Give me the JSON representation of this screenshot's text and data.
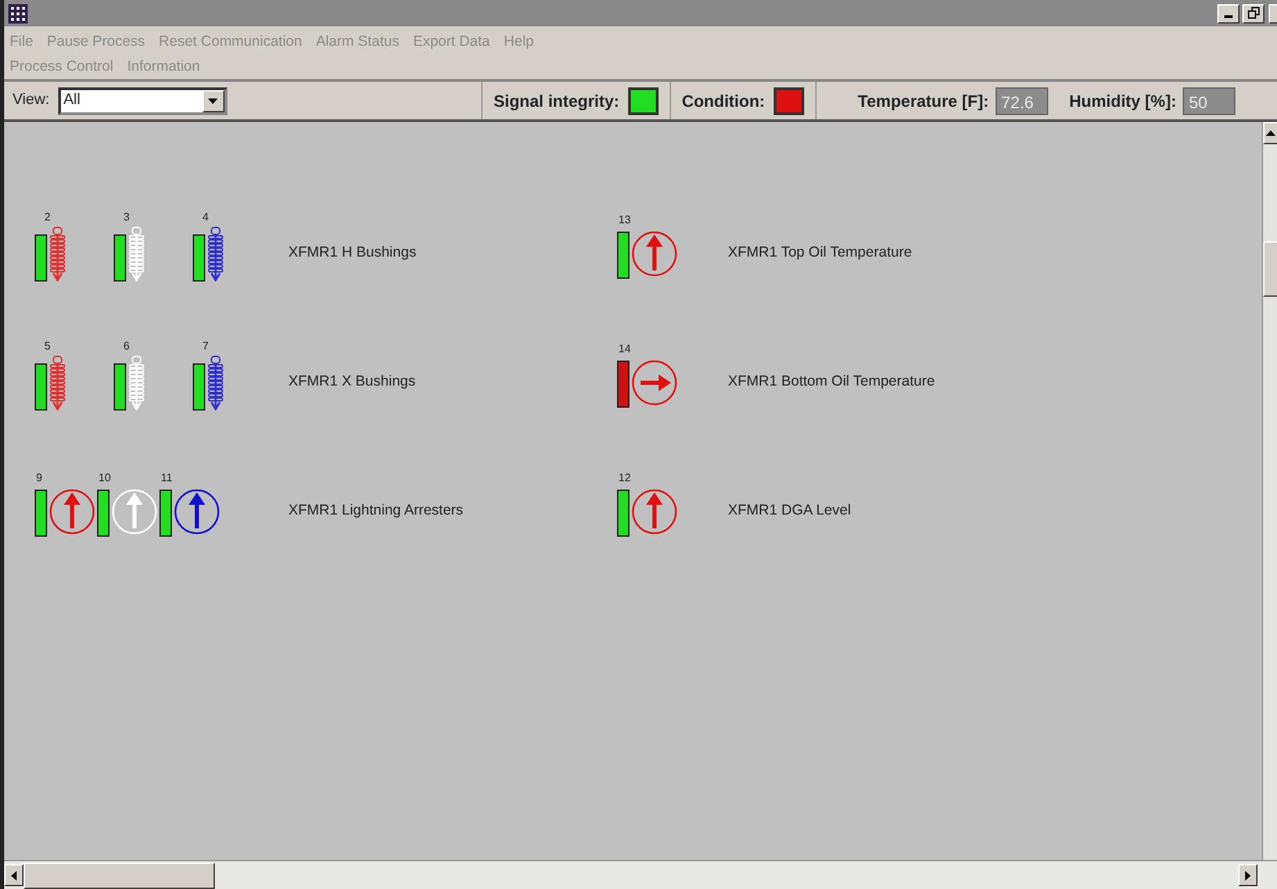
{
  "menu": [
    {
      "label": "File"
    },
    {
      "label": "Pause Process"
    },
    {
      "label": "Reset Communication"
    },
    {
      "label": "Alarm Status"
    },
    {
      "label": "Export Data"
    },
    {
      "label": "Help"
    },
    {
      "label": "Process Control"
    },
    {
      "label": "Information"
    }
  ],
  "toolbar": {
    "view_label": "View:",
    "view_value": "All",
    "indicators": [
      {
        "label": "Signal integrity:",
        "color": "#22dd22"
      },
      {
        "label": "Condition:",
        "color": "#dd1111"
      }
    ],
    "readings": [
      {
        "label": "Temperature [F]:",
        "value": "72.6"
      },
      {
        "label": "Humidity [%]:",
        "value": "50"
      }
    ]
  },
  "groups": [
    {
      "label": "XFMR1 H Bushings",
      "devices": [
        {
          "number": "2",
          "bar": {
            "color": "#22dd22"
          },
          "icon": {
            "kind": "bushing",
            "color": "#e03030"
          }
        },
        {
          "number": "3",
          "bar": {
            "color": "#22dd22"
          },
          "icon": {
            "kind": "bushing",
            "color": "#ffffff"
          }
        },
        {
          "number": "4",
          "bar": {
            "color": "#22dd22"
          },
          "icon": {
            "kind": "bushing",
            "color": "#3030d0"
          }
        }
      ]
    },
    {
      "label": "XFMR1 Top Oil Temperature",
      "devices": [
        {
          "number": "13",
          "bar": {
            "color": "#22dd22"
          },
          "icon": {
            "kind": "arrow-up",
            "color": "#e01010"
          }
        }
      ]
    },
    {
      "label": "XFMR1 X Bushings",
      "devices": [
        {
          "number": "5",
          "bar": {
            "color": "#22dd22"
          },
          "icon": {
            "kind": "bushing",
            "color": "#e03030"
          }
        },
        {
          "number": "6",
          "bar": {
            "color": "#22dd22"
          },
          "icon": {
            "kind": "bushing",
            "color": "#ffffff"
          }
        },
        {
          "number": "7",
          "bar": {
            "color": "#22dd22"
          },
          "icon": {
            "kind": "bushing",
            "color": "#3030d0"
          }
        }
      ]
    },
    {
      "label": "XFMR1 Bottom Oil Temperature",
      "devices": [
        {
          "number": "14",
          "bar": {
            "color": "#cc1111"
          },
          "icon": {
            "kind": "arrow-right",
            "color": "#e01010"
          }
        }
      ]
    },
    {
      "label": "XFMR1 Lightning Arresters",
      "devices": [
        {
          "number": "9",
          "bar": {
            "color": "#22dd22"
          },
          "icon": {
            "kind": "arrow-up",
            "color": "#e01010"
          }
        },
        {
          "number": "10",
          "bar": {
            "color": "#22dd22"
          },
          "icon": {
            "kind": "arrow-up",
            "color": "#ffffff"
          }
        },
        {
          "number": "11",
          "bar": {
            "color": "#22dd22"
          },
          "icon": {
            "kind": "arrow-up",
            "color": "#1010d0"
          }
        }
      ]
    },
    {
      "label": "XFMR1 DGA Level",
      "devices": [
        {
          "number": "12",
          "bar": {
            "color": "#22dd22"
          },
          "icon": {
            "kind": "arrow-up",
            "color": "#e01010"
          }
        }
      ]
    }
  ]
}
